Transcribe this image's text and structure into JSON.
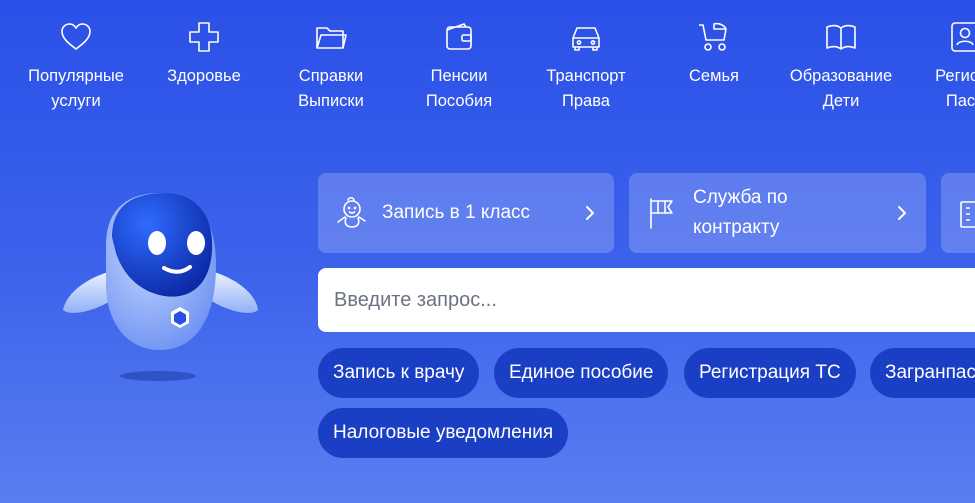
{
  "categories": [
    {
      "label": "Популярные\nуслуги",
      "icon": "heart-icon"
    },
    {
      "label": "Здоровье",
      "icon": "medical-cross-icon"
    },
    {
      "label": "Справки\nВыписки",
      "icon": "folder-icon"
    },
    {
      "label": "Пенсии\nПособия",
      "icon": "wallet-icon"
    },
    {
      "label": "Транспорт\nПрава",
      "icon": "car-icon"
    },
    {
      "label": "Семья",
      "icon": "stroller-icon"
    },
    {
      "label": "Образование\nДети",
      "icon": "open-book-icon"
    },
    {
      "label": "Регистр\nПасп",
      "icon": "person-document-icon"
    }
  ],
  "cards": [
    {
      "label": "Запись в 1 класс",
      "icon": "child-icon"
    },
    {
      "label": "Служба по\nконтракту",
      "icon": "flag-icon"
    },
    {
      "label": "",
      "icon": "building-icon"
    }
  ],
  "search": {
    "placeholder": "Введите запрос..."
  },
  "chips": [
    "Запись к врачу",
    "Единое пособие",
    "Регистрация ТС",
    "Загранпасп",
    "Налоговые уведомления"
  ],
  "colors": {
    "background": "#2a50e8",
    "chip": "#1a3fc4",
    "card": "rgba(255,255,255,0.2)"
  }
}
